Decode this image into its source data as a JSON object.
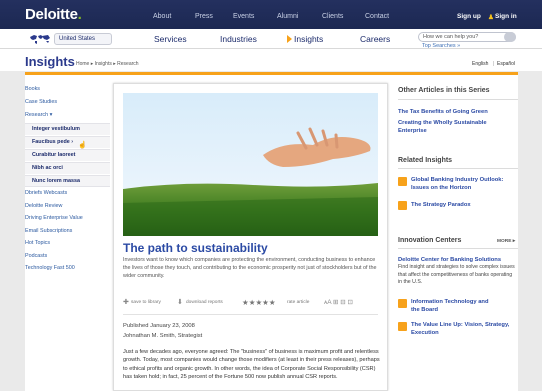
{
  "brand": {
    "name": "Deloitte",
    "dot": ".",
    "accent": "#86bc25",
    "nav_blue": "#1c2852",
    "orange": "#f7a21b"
  },
  "top_nav": {
    "items": [
      "About",
      "Press",
      "Events",
      "Alumni",
      "Clients",
      "Contact"
    ],
    "sign_up": "Sign up",
    "sign_in": "Sign in"
  },
  "country_selector": {
    "label": "United States"
  },
  "main_nav": {
    "items": [
      "Services",
      "Industries",
      "Insights",
      "Careers"
    ],
    "active": "Insights"
  },
  "search": {
    "placeholder": "How we can help you?",
    "top_searches": "Top Searches »"
  },
  "page": {
    "title": "Insights",
    "breadcrumb": "Home  ▸  Insights  ▸  Research",
    "lang_en": "English",
    "lang_sep": "|",
    "lang_es": "Español"
  },
  "left_nav": {
    "items_top": [
      "Books",
      "Case Studies",
      "Research ▾"
    ],
    "sub_items": [
      "Integer vestibulum",
      "Faucibus pede ›",
      "Curabitur laoreet",
      "Nibh ac orci",
      "Nunc lorem massa"
    ],
    "items_bottom": [
      "Dbriefs Webcasts",
      "Deloitte Review",
      "Driving Enterprise Value",
      "Email Subscriptions",
      "Hot Topics",
      "Podcasts",
      "Technology Fast 500"
    ]
  },
  "article": {
    "title": "The path to sustainability",
    "description": "Investors want to know which companies are protecting the environment, conducting business to enhance the lives of those they touch, and contributing to the economic prosperity not just of stockholders but of the wider community.",
    "tools": {
      "save": "save to library",
      "download": "download reports",
      "stars": "★★★★★",
      "rate": "rate article",
      "icons": "ᴀA  ⊞  ⊟  ⊡"
    },
    "published": "Published January 23, 2008",
    "author": "Johnathan M. Smith, Strategist",
    "body": "Just a few decades ago, everyone agreed: The \"business\" of business is maximum profit and relentless growth. Today, most companies would change those modifiers (at least in their press releases), perhaps to ethical profits and organic growth. In other words, the idea of Corporate Social Responsibility (CSR) has taken hold; in fact, 25 percent of the Fortune 500 now publish annual CSR reports."
  },
  "sidebar": {
    "other_articles": {
      "heading": "Other Articles in this Series",
      "links": [
        "The Tax Benefits of Going Green",
        "Creating the Wholly Sustainable Enterprise"
      ]
    },
    "related": {
      "heading": "Related Insights",
      "links": [
        "Global Banking Industry Outlook: Issues on the Horizon",
        "The Strategy Paradox"
      ]
    },
    "innovation": {
      "heading": "Innovation Centers",
      "more": "MORE ▸",
      "center_title": "Deloitte Center for Banking Solutions",
      "center_text": "Find insight and strategies to solve complex issues that affect the competitiveness of banks operating in the U.S.",
      "links": [
        "Information Technology and the Board",
        "The Value Line Up: Vision, Strategy, Execution"
      ]
    }
  }
}
